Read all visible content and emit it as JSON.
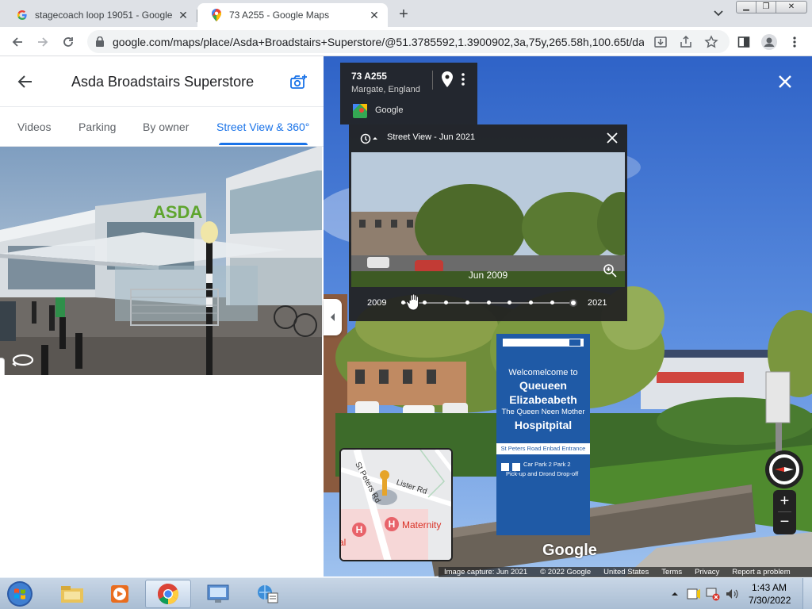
{
  "browser": {
    "tabs": [
      {
        "title": "stagecoach loop 19051 - Google",
        "favicon": "google-g-icon"
      },
      {
        "title": "73 A255 - Google Maps",
        "favicon": "google-maps-icon"
      }
    ],
    "new_tab": "+",
    "url": "google.com/maps/place/Asda+Broadstairs+Superstore/@51.3785592,1.3900902,3a,75y,265.58h,100.65t/da..."
  },
  "left_panel": {
    "title": "Asda Broadstairs Superstore",
    "tabs": [
      {
        "label": "Videos"
      },
      {
        "label": "Parking"
      },
      {
        "label": "By owner"
      },
      {
        "label": "Street View & 360°",
        "active": true
      }
    ]
  },
  "streetview": {
    "address_card": {
      "title": "73 A255",
      "subtitle": "Margate, England",
      "source": "Google"
    },
    "time_machine": {
      "title": "Street View - Jun 2021",
      "preview_date": "Jun 2009",
      "year_start": "2009",
      "year_end": "2021",
      "dates_count": 9
    },
    "minimap": {
      "street_1": "St Peters Rd",
      "street_2": "Lister Rd",
      "poi": "Maternity",
      "poi_cut": "al"
    },
    "sign": {
      "line1": "Welcomelcome to",
      "line2": "Queueen",
      "line3": "Elizabeabeth",
      "line4": "The Queen Neen Mother",
      "line5": "Hospitpital",
      "line6": "St Peters Road Enbad Entrance",
      "line7": "Car Park 2 Park 2",
      "line8": "Pick-up and Drond Drop-off"
    },
    "watermark": "Google",
    "footer": [
      "Image capture: Jun 2021",
      "© 2022 Google",
      "United States",
      "Terms",
      "Privacy",
      "Report a problem"
    ]
  },
  "taskbar": {
    "time": "1:43 AM",
    "date": "7/30/2022"
  },
  "colors": {
    "accent": "#1a73e8",
    "panel_dark": "#222222",
    "sign_blue": "#1f5aa6"
  }
}
